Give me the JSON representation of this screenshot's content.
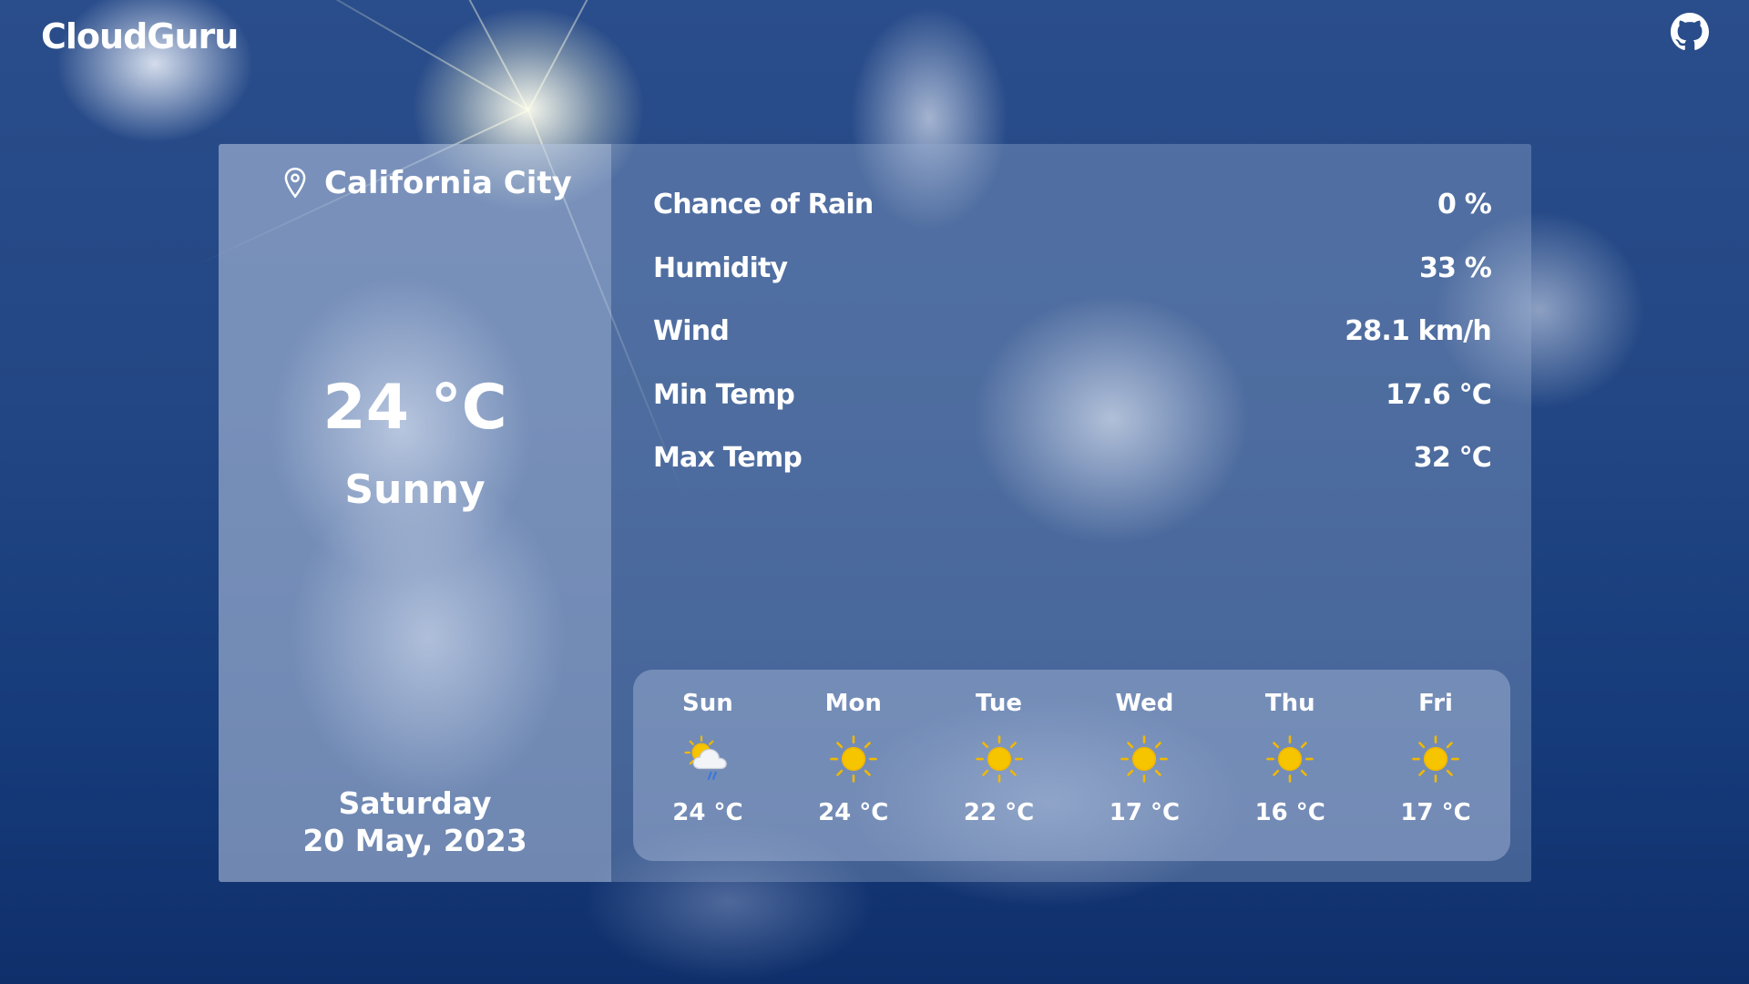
{
  "app": {
    "brand": "CloudGuru",
    "github_icon": "github-icon"
  },
  "current": {
    "location": "California City",
    "location_icon": "map-pin-icon",
    "temperature": "24 °C",
    "condition": "Sunny",
    "weekday": "Saturday",
    "date": "20 May, 2023"
  },
  "details": [
    {
      "label": "Chance of Rain",
      "value": "0 %"
    },
    {
      "label": "Humidity",
      "value": "33 %"
    },
    {
      "label": "Wind",
      "value": "28.1 km/h"
    },
    {
      "label": "Min Temp",
      "value": "17.6 °C"
    },
    {
      "label": "Max Temp",
      "value": "32 °C"
    }
  ],
  "forecast": [
    {
      "day": "Sun",
      "icon": "sun-cloud-rain-icon",
      "temp": "24 °C"
    },
    {
      "day": "Mon",
      "icon": "sun-icon",
      "temp": "24 °C"
    },
    {
      "day": "Tue",
      "icon": "sun-icon",
      "temp": "22 °C"
    },
    {
      "day": "Wed",
      "icon": "sun-icon",
      "temp": "17 °C"
    },
    {
      "day": "Thu",
      "icon": "sun-icon",
      "temp": "16 °C"
    },
    {
      "day": "Fri",
      "icon": "sun-icon",
      "temp": "17 °C"
    }
  ],
  "colors": {
    "text": "#ffffff",
    "sun": "#f7c400",
    "sun_ray": "#f0b800",
    "cloud": "#f2f4f8",
    "rain": "#3a78d8"
  }
}
